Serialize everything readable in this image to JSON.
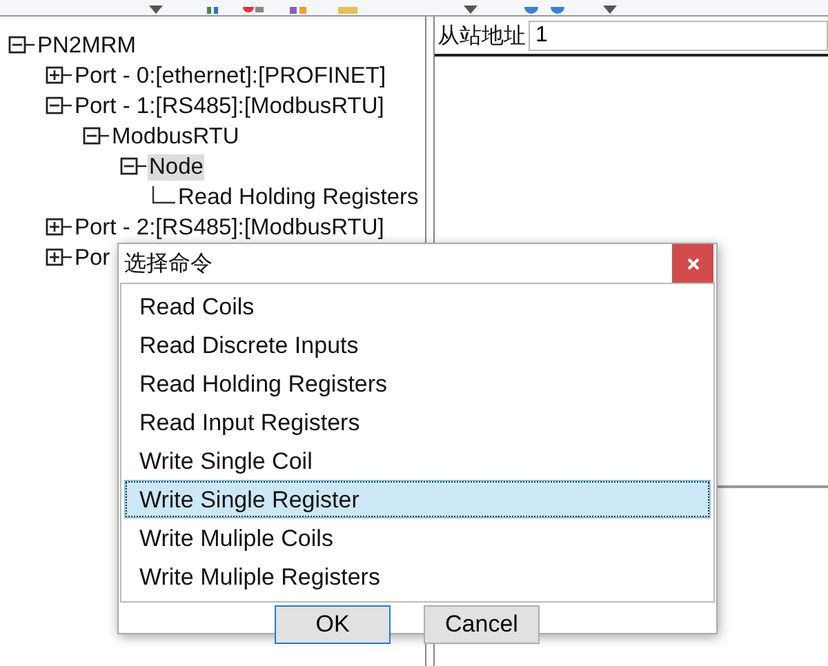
{
  "tree": [
    {
      "label": "PN2MRM",
      "expanded": true,
      "selected": false,
      "children": [
        {
          "label": "Port - 0:[ethernet]:[PROFINET]",
          "expanded": false,
          "selected": false
        },
        {
          "label": "Port - 1:[RS485]:[ModbusRTU]",
          "expanded": true,
          "selected": false,
          "children": [
            {
              "label": "ModbusRTU",
              "expanded": true,
              "selected": false,
              "children": [
                {
                  "label": "Node",
                  "expanded": true,
                  "selected": true,
                  "children": [
                    {
                      "label": "Read Holding Registers",
                      "selected": false
                    }
                  ]
                }
              ]
            }
          ]
        },
        {
          "label": "Port - 2:[RS485]:[ModbusRTU]",
          "expanded": false,
          "selected": false
        },
        {
          "label": "Por",
          "expanded": false,
          "selected": false
        }
      ]
    }
  ],
  "detail": {
    "label": "从站地址",
    "value": "1"
  },
  "dialog": {
    "title": "选择命令",
    "items": [
      {
        "label": "Read Coils",
        "selected": false
      },
      {
        "label": "Read Discrete Inputs",
        "selected": false
      },
      {
        "label": "Read Holding Registers",
        "selected": false
      },
      {
        "label": "Read Input Registers",
        "selected": false
      },
      {
        "label": "Write Single Coil",
        "selected": false
      },
      {
        "label": "Write Single Register",
        "selected": true
      },
      {
        "label": "Write Muliple Coils",
        "selected": false
      },
      {
        "label": "Write Muliple Registers",
        "selected": false
      }
    ],
    "buttons": [
      {
        "label": "OK",
        "focused": true
      },
      {
        "label": "Cancel",
        "focused": false
      }
    ]
  }
}
